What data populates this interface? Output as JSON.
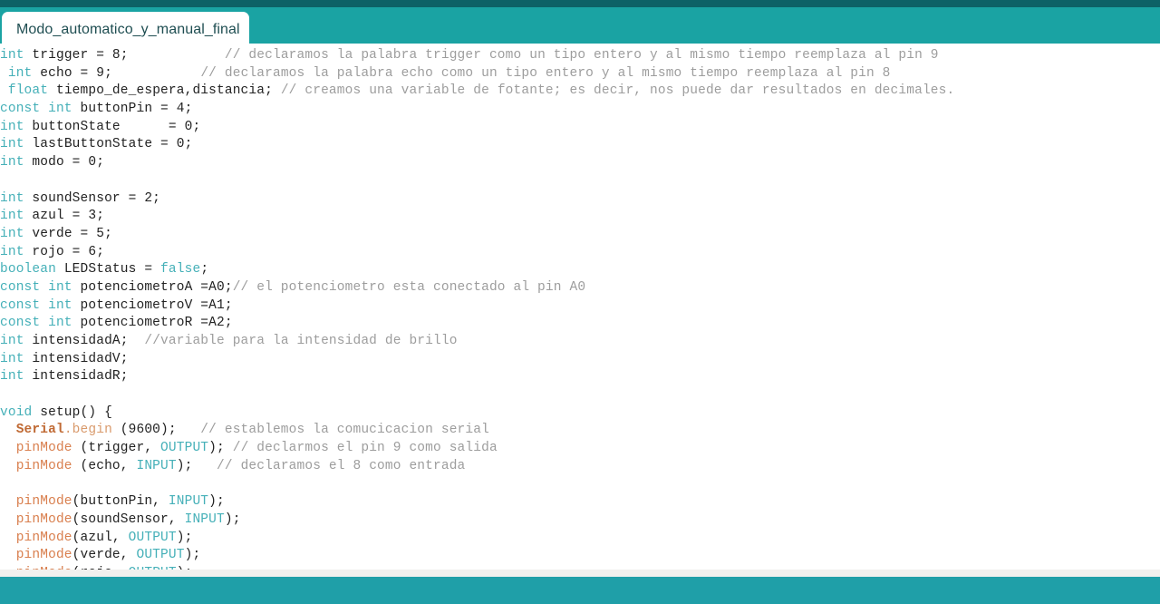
{
  "window": {
    "title": "Modo_automatico_y_manual_final"
  },
  "colors": {
    "titlebar_dark_teal": "#0d6166",
    "tabbar_teal": "#1aa3a3",
    "footer_teal": "#1f9fa8",
    "status_strip": "#f0f0ee",
    "editor_background": "#ffffff",
    "keyword": "#45b0b8",
    "comment": "#9d9d9d",
    "function": "#d97f4e",
    "object": "#c06a34",
    "method": "#d99a6c",
    "identifier": "#222222",
    "tab_label": "#1f4e52"
  },
  "tabs": [
    {
      "label": "Modo_automatico_y_manual_final",
      "active": true
    }
  ],
  "editor": {
    "language": "arduino-cpp",
    "lines": [
      {
        "n": 1,
        "tokens": [
          {
            "t": "kw",
            "s": "int"
          },
          {
            "t": "id",
            "s": " trigger = 8;            "
          },
          {
            "t": "cmt",
            "s": "// declaramos la palabra trigger como un tipo entero y al mismo tiempo reemplaza al pin 9"
          }
        ]
      },
      {
        "n": 2,
        "tokens": [
          {
            "t": "id",
            "s": " "
          },
          {
            "t": "kw",
            "s": "int"
          },
          {
            "t": "id",
            "s": " echo = 9;           "
          },
          {
            "t": "cmt",
            "s": "// declaramos la palabra echo como un tipo entero y al mismo tiempo reemplaza al pin 8"
          }
        ]
      },
      {
        "n": 3,
        "tokens": [
          {
            "t": "id",
            "s": " "
          },
          {
            "t": "kw",
            "s": "float"
          },
          {
            "t": "id",
            "s": " tiempo_de_espera,distancia; "
          },
          {
            "t": "cmt",
            "s": "// creamos una variable de fotante; es decir, nos puede dar resultados en decimales."
          }
        ]
      },
      {
        "n": 4,
        "tokens": [
          {
            "t": "kw",
            "s": "const int"
          },
          {
            "t": "id",
            "s": " buttonPin = 4;"
          }
        ]
      },
      {
        "n": 5,
        "tokens": [
          {
            "t": "kw",
            "s": "int"
          },
          {
            "t": "id",
            "s": " buttonState      = 0;"
          }
        ]
      },
      {
        "n": 6,
        "tokens": [
          {
            "t": "kw",
            "s": "int"
          },
          {
            "t": "id",
            "s": " lastButtonState = 0;"
          }
        ]
      },
      {
        "n": 7,
        "tokens": [
          {
            "t": "kw",
            "s": "int"
          },
          {
            "t": "id",
            "s": " modo = 0;"
          }
        ]
      },
      {
        "n": 8,
        "tokens": []
      },
      {
        "n": 9,
        "tokens": [
          {
            "t": "kw",
            "s": "int"
          },
          {
            "t": "id",
            "s": " soundSensor = 2;"
          }
        ]
      },
      {
        "n": 10,
        "tokens": [
          {
            "t": "kw",
            "s": "int"
          },
          {
            "t": "id",
            "s": " azul = 3;"
          }
        ]
      },
      {
        "n": 11,
        "tokens": [
          {
            "t": "kw",
            "s": "int"
          },
          {
            "t": "id",
            "s": " verde = 5;"
          }
        ]
      },
      {
        "n": 12,
        "tokens": [
          {
            "t": "kw",
            "s": "int"
          },
          {
            "t": "id",
            "s": " rojo = 6;"
          }
        ]
      },
      {
        "n": 13,
        "tokens": [
          {
            "t": "kw",
            "s": "boolean"
          },
          {
            "t": "id",
            "s": " LEDStatus = "
          },
          {
            "t": "lit",
            "s": "false"
          },
          {
            "t": "id",
            "s": ";"
          }
        ]
      },
      {
        "n": 14,
        "tokens": [
          {
            "t": "kw",
            "s": "const int"
          },
          {
            "t": "id",
            "s": " potenciometroA =A0;"
          },
          {
            "t": "cmt",
            "s": "// el potenciometro esta conectado al pin A0"
          }
        ]
      },
      {
        "n": 15,
        "tokens": [
          {
            "t": "kw",
            "s": "const int"
          },
          {
            "t": "id",
            "s": " potenciometroV =A1;"
          }
        ]
      },
      {
        "n": 16,
        "tokens": [
          {
            "t": "kw",
            "s": "const int"
          },
          {
            "t": "id",
            "s": " potenciometroR =A2;"
          }
        ]
      },
      {
        "n": 17,
        "tokens": [
          {
            "t": "kw",
            "s": "int"
          },
          {
            "t": "id",
            "s": " intensidadA;  "
          },
          {
            "t": "cmt",
            "s": "//variable para la intensidad de brillo"
          }
        ]
      },
      {
        "n": 18,
        "tokens": [
          {
            "t": "kw",
            "s": "int"
          },
          {
            "t": "id",
            "s": " intensidadV;"
          }
        ]
      },
      {
        "n": 19,
        "tokens": [
          {
            "t": "kw",
            "s": "int"
          },
          {
            "t": "id",
            "s": " intensidadR;"
          }
        ]
      },
      {
        "n": 20,
        "tokens": []
      },
      {
        "n": 21,
        "tokens": [
          {
            "t": "kw",
            "s": "void"
          },
          {
            "t": "id",
            "s": " setup() {"
          }
        ]
      },
      {
        "n": 22,
        "tokens": [
          {
            "t": "id",
            "s": "  "
          },
          {
            "t": "obj",
            "s": "Serial"
          },
          {
            "t": "mth",
            "s": ".begin"
          },
          {
            "t": "id",
            "s": " (9600);   "
          },
          {
            "t": "cmt",
            "s": "// establemos la comucicacion serial"
          }
        ]
      },
      {
        "n": 23,
        "tokens": [
          {
            "t": "id",
            "s": "  "
          },
          {
            "t": "fn",
            "s": "pinMode"
          },
          {
            "t": "id",
            "s": " (trigger, "
          },
          {
            "t": "lit",
            "s": "OUTPUT"
          },
          {
            "t": "id",
            "s": "); "
          },
          {
            "t": "cmt",
            "s": "// declarmos el pin 9 como salida"
          }
        ]
      },
      {
        "n": 24,
        "tokens": [
          {
            "t": "id",
            "s": "  "
          },
          {
            "t": "fn",
            "s": "pinMode"
          },
          {
            "t": "id",
            "s": " (echo, "
          },
          {
            "t": "lit",
            "s": "INPUT"
          },
          {
            "t": "id",
            "s": ");   "
          },
          {
            "t": "cmt",
            "s": "// declaramos el 8 como entrada"
          }
        ]
      },
      {
        "n": 25,
        "tokens": []
      },
      {
        "n": 26,
        "tokens": [
          {
            "t": "id",
            "s": "  "
          },
          {
            "t": "fn",
            "s": "pinMode"
          },
          {
            "t": "id",
            "s": "(buttonPin, "
          },
          {
            "t": "lit",
            "s": "INPUT"
          },
          {
            "t": "id",
            "s": ");"
          }
        ]
      },
      {
        "n": 27,
        "tokens": [
          {
            "t": "id",
            "s": "  "
          },
          {
            "t": "fn",
            "s": "pinMode"
          },
          {
            "t": "id",
            "s": "(soundSensor, "
          },
          {
            "t": "lit",
            "s": "INPUT"
          },
          {
            "t": "id",
            "s": ");"
          }
        ]
      },
      {
        "n": 28,
        "tokens": [
          {
            "t": "id",
            "s": "  "
          },
          {
            "t": "fn",
            "s": "pinMode"
          },
          {
            "t": "id",
            "s": "(azul, "
          },
          {
            "t": "lit",
            "s": "OUTPUT"
          },
          {
            "t": "id",
            "s": ");"
          }
        ]
      },
      {
        "n": 29,
        "tokens": [
          {
            "t": "id",
            "s": "  "
          },
          {
            "t": "fn",
            "s": "pinMode"
          },
          {
            "t": "id",
            "s": "(verde, "
          },
          {
            "t": "lit",
            "s": "OUTPUT"
          },
          {
            "t": "id",
            "s": ");"
          }
        ]
      },
      {
        "n": 30,
        "tokens": [
          {
            "t": "id",
            "s": "  "
          },
          {
            "t": "fn",
            "s": "pinMode"
          },
          {
            "t": "id",
            "s": "(rojo, "
          },
          {
            "t": "lit",
            "s": "OUTPUT"
          },
          {
            "t": "id",
            "s": ");"
          }
        ]
      },
      {
        "n": 31,
        "tokens": [
          {
            "t": "id",
            "s": "."
          }
        ]
      }
    ]
  }
}
